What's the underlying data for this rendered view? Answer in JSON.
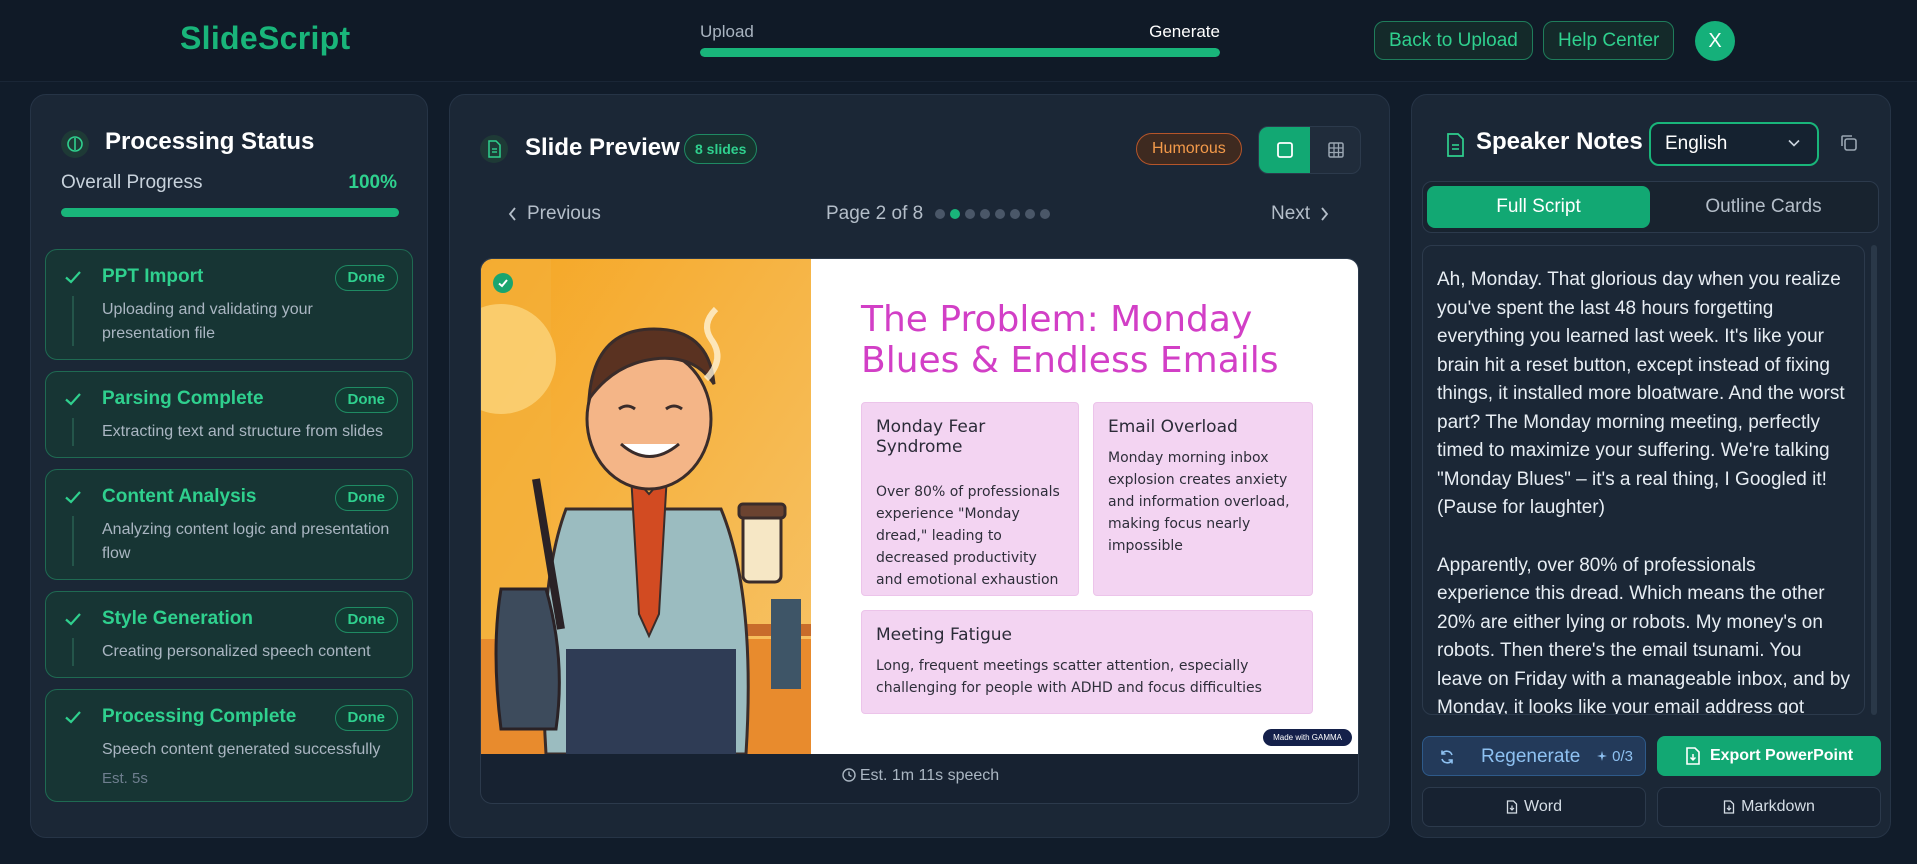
{
  "header": {
    "logo": "SlideScript",
    "steps": {
      "start_label": "Upload",
      "end_label": "Generate",
      "progress_percent": 100
    },
    "back_button": "Back to Upload",
    "help_button": "Help Center",
    "avatar_initial": "X"
  },
  "status_panel": {
    "title": "Processing Status",
    "overall_label": "Overall Progress",
    "overall_value": "100%",
    "overall_fraction": 1.0,
    "stages": [
      {
        "title": "PPT Import",
        "badge": "Done",
        "description": "Uploading and validating your presentation file"
      },
      {
        "title": "Parsing Complete",
        "badge": "Done",
        "description": "Extracting text and structure from slides"
      },
      {
        "title": "Content Analysis",
        "badge": "Done",
        "description": "Analyzing content logic and presentation flow"
      },
      {
        "title": "Style Generation",
        "badge": "Done",
        "description": "Creating personalized speech content"
      },
      {
        "title": "Processing Complete",
        "badge": "Done",
        "description": "Speech content generated successfully",
        "estimate": "Est. 5s"
      }
    ]
  },
  "preview_panel": {
    "title": "Slide Preview",
    "count_badge": "8 slides",
    "tone_badge": "Humorous",
    "prev_label": "Previous",
    "next_label": "Next",
    "page_label": "Page 2 of 8",
    "current_page": 2,
    "total_pages": 8,
    "slide": {
      "title": "The Problem: Monday Blues & Endless Emails",
      "cards": [
        {
          "title": "Monday Fear Syndrome",
          "text": "Over 80% of professionals experience \"Monday dread,\" leading to decreased productivity and emotional exhaustion"
        },
        {
          "title": "Email Overload",
          "text": "Monday morning inbox explosion creates anxiety and information overload, making focus nearly impossible"
        },
        {
          "title": "Meeting Fatigue",
          "text": "Long, frequent meetings scatter attention, especially challenging for people with ADHD and focus difficulties"
        }
      ],
      "watermark": "Made with GAMMA"
    },
    "estimate": "Est. 1m 11s speech"
  },
  "notes_panel": {
    "title": "Speaker Notes",
    "language": "English",
    "tabs": [
      "Full Script",
      "Outline Cards"
    ],
    "paragraphs": [
      "Ah, Monday. That glorious day when you realize you've spent the last 48 hours forgetting everything you learned last week. It's like your brain hit a reset button, except instead of fixing things, it installed more bloatware. And the worst part? The Monday morning meeting, perfectly timed to maximize your suffering. We're talking \"Monday Blues\" – it's a real thing, I Googled it! (Pause for laughter)",
      "Apparently, over 80% of professionals experience this dread. Which means the other 20% are either lying or robots. My money's on robots. Then there's the email tsunami. You leave on Friday with a manageable inbox, and by Monday, it looks like your email address got"
    ],
    "regenerate_label": "Regenerate",
    "regenerate_count": "0/3",
    "export_label": "Export PowerPoint",
    "word_label": "Word",
    "markdown_label": "Markdown"
  },
  "colors": {
    "accent": "#19b57a",
    "background": "#111c2a",
    "panel": "#1b2736",
    "slide_title": "#d23fc6",
    "tone": "#f39a4a"
  }
}
